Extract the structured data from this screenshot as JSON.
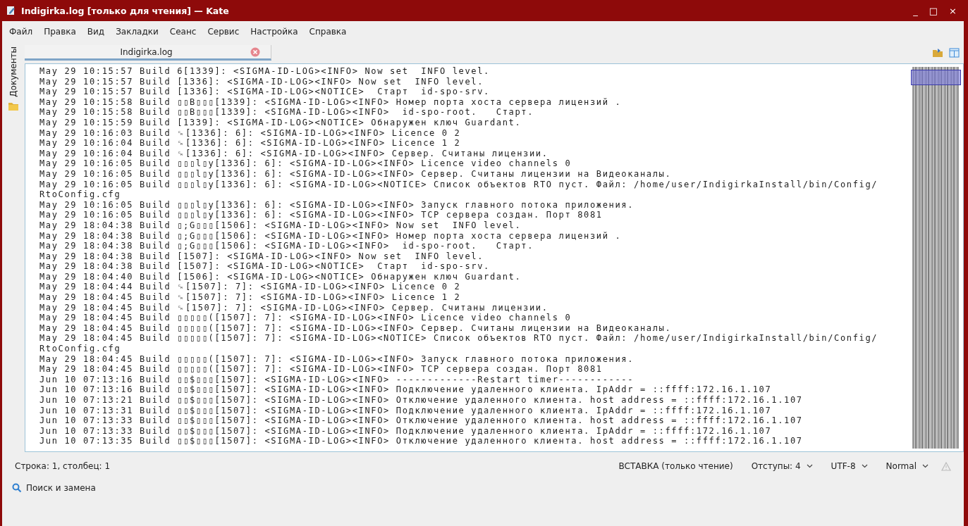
{
  "window": {
    "title": "Indigirka.log [только для чтения] — Kate",
    "controls": [
      "_",
      "□",
      "×"
    ]
  },
  "menu": [
    "Файл",
    "Правка",
    "Вид",
    "Закладки",
    "Сеанс",
    "Сервис",
    "Настройка",
    "Справка"
  ],
  "sidebar": {
    "label": "Документы"
  },
  "tabs": [
    {
      "label": "Indigirka.log",
      "selected": true
    }
  ],
  "editor": {
    "lines": [
      "May 29 10:15:57 Build 6[1339]: <SIGMA-ID-LOG><INFO> Now set  INFO level.",
      "May 29 10:15:57 Build [1336]: <SIGMA-ID-LOG><INFO> Now set  INFO level.",
      "May 29 10:15:57 Build [1336]: <SIGMA-ID-LOG><NOTICE>  Старт  id-spo-srv.",
      "May 29 10:15:58 Build ▯▯B▯▯▯[1339]: <SIGMA-ID-LOG><INFO> Номер порта хоста сервера лицензий .",
      "May 29 10:15:58 Build ▯▯B▯▯▯[1339]: <SIGMA-ID-LOG><INFO>  id-spo-root.   Старт.",
      "May 29 10:15:59 Build [1339]: <SIGMA-ID-LOG><NOTICE> Обнаружен ключ Guardant.",
      "May 29 10:16:03 Build ␍[1336]: 6]: <SIGMA-ID-LOG><INFO> Licence 0 2",
      "May 29 10:16:04 Build ␍[1336]: 6]: <SIGMA-ID-LOG><INFO> Licence 1 2",
      "May 29 10:16:04 Build ␍[1336]: 6]: <SIGMA-ID-LOG><INFO> Сервер. Считаны лицензии.",
      "May 29 10:16:05 Build ▯▯▯l▯y[1336]: 6]: <SIGMA-ID-LOG><INFO> Licence video channels 0",
      "May 29 10:16:05 Build ▯▯▯l▯y[1336]: 6]: <SIGMA-ID-LOG><INFO> Сервер. Считаны лицензии на Видеоканалы.",
      "May 29 10:16:05 Build ▯▯▯l▯y[1336]: 6]: <SIGMA-ID-LOG><NOTICE> Список объектов RTO пуст. Файл: /home/user/IndigirkaInstall/bin/Config/",
      "RtoConfig.cfg",
      "May 29 10:16:05 Build ▯▯▯l▯y[1336]: 6]: <SIGMA-ID-LOG><INFO> Запуск главного потока приложения.",
      "May 29 10:16:05 Build ▯▯▯l▯y[1336]: 6]: <SIGMA-ID-LOG><INFO> TCP сервера создан. Порт 8081",
      "May 29 18:04:38 Build ▯;G▯▯▯[1506]: <SIGMA-ID-LOG><INFO> Now set  INFO level.",
      "May 29 18:04:38 Build ▯;G▯▯▯[1506]: <SIGMA-ID-LOG><INFO> Номер порта хоста сервера лицензий .",
      "May 29 18:04:38 Build ▯;G▯▯▯[1506]: <SIGMA-ID-LOG><INFO>  id-spo-root.   Старт.",
      "May 29 18:04:38 Build [1507]: <SIGMA-ID-LOG><INFO> Now set  INFO level.",
      "May 29 18:04:38 Build [1507]: <SIGMA-ID-LOG><NOTICE>  Старт  id-spo-srv.",
      "May 29 18:04:40 Build [1506]: <SIGMA-ID-LOG><NOTICE> Обнаружен ключ Guardant.",
      "May 29 18:04:44 Build ␍[1507]: 7]: <SIGMA-ID-LOG><INFO> Licence 0 2",
      "May 29 18:04:45 Build ␍[1507]: 7]: <SIGMA-ID-LOG><INFO> Licence 1 2",
      "May 29 18:04:45 Build ␍[1507]: 7]: <SIGMA-ID-LOG><INFO> Сервер. Считаны лицензии.",
      "May 29 18:04:45 Build ▯▯▯▯▯([1507]: 7]: <SIGMA-ID-LOG><INFO> Licence video channels 0",
      "May 29 18:04:45 Build ▯▯▯▯▯([1507]: 7]: <SIGMA-ID-LOG><INFO> Сервер. Считаны лицензии на Видеоканалы.",
      "May 29 18:04:45 Build ▯▯▯▯▯([1507]: 7]: <SIGMA-ID-LOG><NOTICE> Список объектов RTO пуст. Файл: /home/user/IndigirkaInstall/bin/Config/",
      "RtoConfig.cfg",
      "May 29 18:04:45 Build ▯▯▯▯▯([1507]: 7]: <SIGMA-ID-LOG><INFO> Запуск главного потока приложения.",
      "May 29 18:04:45 Build ▯▯▯▯▯([1507]: 7]: <SIGMA-ID-LOG><INFO> TCP сервера создан. Порт 8081",
      "Jun 10 07:13:16 Build ▯▯$▯▯▯[1507]: <SIGMA-ID-LOG><INFO> -------------Restart timer------------",
      "Jun 10 07:13:16 Build ▯▯$▯▯▯[1507]: <SIGMA-ID-LOG><INFO> Подключение удаленного клиента. IpAddr = ::ffff:172.16.1.107",
      "Jun 10 07:13:21 Build ▯▯$▯▯▯[1507]: <SIGMA-ID-LOG><INFO> Отключение удаленного клиента. host address = ::ffff:172.16.1.107",
      "Jun 10 07:13:31 Build ▯▯$▯▯▯[1507]: <SIGMA-ID-LOG><INFO> Подключение удаленного клиента. IpAddr = ::ffff:172.16.1.107",
      "Jun 10 07:13:33 Build ▯▯$▯▯▯[1507]: <SIGMA-ID-LOG><INFO> Отключение удаленного клиента. host address = ::ffff:172.16.1.107",
      "Jun 10 07:13:33 Build ▯▯$▯▯▯[1507]: <SIGMA-ID-LOG><INFO> Подключение удаленного клиента. IpAddr = ::ffff:172.16.1.107",
      "Jun 10 07:13:35 Build ▯▯$▯▯▯[1507]: <SIGMA-ID-LOG><INFO> Отключение удаленного клиента. host address = ::ffff:172.16.1.107"
    ]
  },
  "status_bar": {
    "position": "Строка: 1, столбец: 1",
    "mode": "ВСТАВКА (только чтение)",
    "dropdowns": [
      "Отступы: 4",
      "UTF-8",
      "Normal"
    ]
  },
  "search_panel": {
    "label": "Поиск и замена"
  }
}
